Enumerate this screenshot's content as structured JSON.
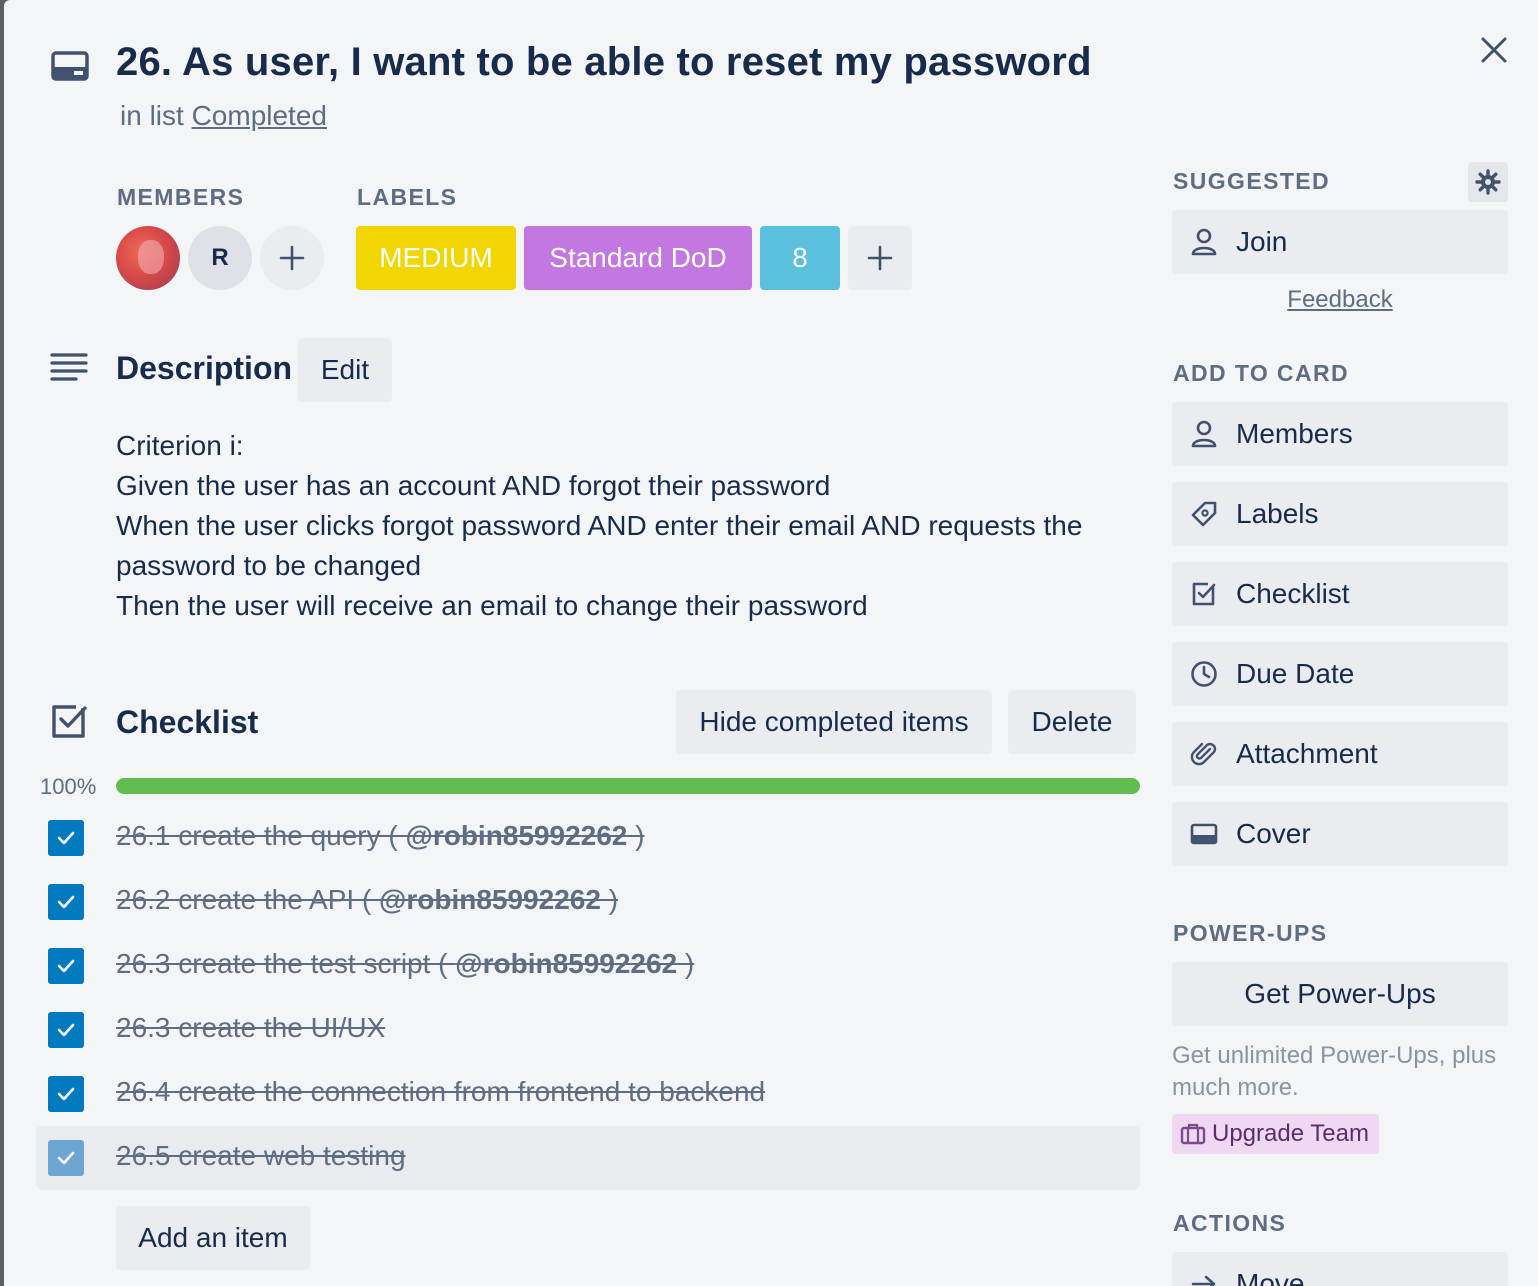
{
  "card": {
    "title": "26. As user, I want to be able to reset my password",
    "in_list_prefix": "in list ",
    "list_name": "Completed"
  },
  "members": {
    "label": "MEMBERS",
    "avatars": [
      {
        "type": "photo",
        "initial": ""
      },
      {
        "type": "initial",
        "initial": "R"
      }
    ],
    "add_symbol": "+"
  },
  "labels": {
    "label": "LABELS",
    "items": [
      {
        "text": "MEDIUM",
        "color": "#f2d600"
      },
      {
        "text": "Standard DoD",
        "color": "#c377e0"
      },
      {
        "text": "8",
        "color": "#5bc0de"
      }
    ]
  },
  "description": {
    "heading": "Description",
    "edit_label": "Edit",
    "lines": [
      "Criterion i:",
      "Given the user has an account AND forgot their password",
      "When the user clicks forgot password AND enter their email AND requests the password to be changed",
      "Then the user will receive an email to change their password"
    ]
  },
  "checklist": {
    "heading": "Checklist",
    "hide_label": "Hide completed items",
    "delete_label": "Delete",
    "progress_text": "100%",
    "progress_value": 1.0,
    "items": [
      {
        "text": "26.1 create the query ( ",
        "mention": "@robin85992262",
        "suffix": " )",
        "checked": true
      },
      {
        "text": "26.2 create the API ( ",
        "mention": "@robin85992262",
        "suffix": " )",
        "checked": true
      },
      {
        "text": "26.3 create the test script ( ",
        "mention": "@robin85992262",
        "suffix": " )",
        "checked": true
      },
      {
        "text": "26.3 create the UI/UX",
        "mention": "",
        "suffix": "",
        "checked": true
      },
      {
        "text": "26.4 create the connection from frontend to backend",
        "mention": "",
        "suffix": "",
        "checked": true
      },
      {
        "text": "26.5 create web testing",
        "mention": "",
        "suffix": "",
        "checked": true
      }
    ],
    "add_item_label": "Add an item"
  },
  "sidebar": {
    "suggested_label": "SUGGESTED",
    "join_label": "Join",
    "feedback_label": "Feedback",
    "add_to_card_label": "ADD TO CARD",
    "add_to_card": [
      {
        "label": "Members",
        "icon": "person-icon"
      },
      {
        "label": "Labels",
        "icon": "tag-icon"
      },
      {
        "label": "Checklist",
        "icon": "checklist-icon"
      },
      {
        "label": "Due Date",
        "icon": "clock-icon"
      },
      {
        "label": "Attachment",
        "icon": "paperclip-icon"
      },
      {
        "label": "Cover",
        "icon": "cover-icon"
      }
    ],
    "power_ups_label": "POWER-UPS",
    "get_power_ups_label": "Get Power-Ups",
    "promo_text": "Get unlimited Power-Ups, plus much more.",
    "upgrade_label": "Upgrade Team",
    "actions_label": "ACTIONS",
    "move_label": "Move"
  },
  "colors": {
    "accent": "#0079bf",
    "progress": "#61bd4f",
    "background": "#f4f5f7"
  }
}
